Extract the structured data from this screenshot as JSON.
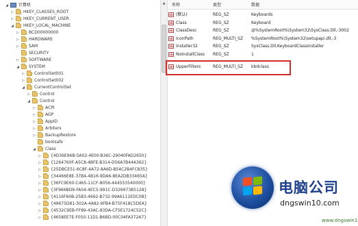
{
  "tree": {
    "items": [
      {
        "label": "计算机",
        "depth": 0,
        "icon": "computer-icon",
        "expander": "expanded"
      },
      {
        "label": "HKEY_CLASSES_ROOT",
        "depth": 1,
        "icon": "folder-icon",
        "expander": "collapsed"
      },
      {
        "label": "HKEY_CURRENT_USER",
        "depth": 1,
        "icon": "folder-icon",
        "expander": "collapsed"
      },
      {
        "label": "HKEY_LOCAL_MACHINE",
        "depth": 1,
        "icon": "folder-icon",
        "expander": "expanded"
      },
      {
        "label": "BCD00000000",
        "depth": 2,
        "icon": "folder-icon",
        "expander": "collapsed"
      },
      {
        "label": "HARDWARE",
        "depth": 2,
        "icon": "folder-icon",
        "expander": "collapsed"
      },
      {
        "label": "SAM",
        "depth": 2,
        "icon": "folder-icon",
        "expander": "collapsed"
      },
      {
        "label": "SECURITY",
        "depth": 2,
        "icon": "folder-icon",
        "expander": "none"
      },
      {
        "label": "SOFTWARE",
        "depth": 2,
        "icon": "folder-icon",
        "expander": "collapsed"
      },
      {
        "label": "SYSTEM",
        "depth": 2,
        "icon": "folder-icon",
        "expander": "expanded"
      },
      {
        "label": "ControlSet001",
        "depth": 3,
        "icon": "folder-icon",
        "expander": "collapsed"
      },
      {
        "label": "ControlSet002",
        "depth": 3,
        "icon": "folder-icon",
        "expander": "collapsed"
      },
      {
        "label": "CurrentControlSet",
        "depth": 3,
        "icon": "folder-icon",
        "expander": "expanded"
      },
      {
        "label": "Control",
        "depth": 4,
        "icon": "folder-icon",
        "expander": "collapsed"
      },
      {
        "label": "Control",
        "depth": 4,
        "icon": "folder-icon",
        "expander": "expanded"
      },
      {
        "label": "ACPI",
        "depth": 5,
        "icon": "folder-icon",
        "expander": "collapsed"
      },
      {
        "label": "AGP",
        "depth": 5,
        "icon": "folder-icon",
        "expander": "collapsed"
      },
      {
        "label": "AppID",
        "depth": 5,
        "icon": "folder-icon",
        "expander": "collapsed"
      },
      {
        "label": "Arbiters",
        "depth": 5,
        "icon": "folder-icon",
        "expander": "collapsed"
      },
      {
        "label": "BackupRestore",
        "depth": 5,
        "icon": "folder-icon",
        "expander": "collapsed"
      },
      {
        "label": "bootsafe",
        "depth": 5,
        "icon": "folder-icon",
        "expander": "none"
      },
      {
        "label": "Class",
        "depth": 5,
        "icon": "folder-icon",
        "expander": "expanded"
      },
      {
        "label": "{4D36E96B-5A02-4E00-B36C-29040FAD2650}",
        "depth": 6,
        "icon": "folder-icon",
        "expander": "collapsed"
      },
      {
        "label": "{1264760F-A5C8-4BFE-B314-D56A7B44A362}",
        "depth": 6,
        "icon": "folder-icon",
        "expander": "collapsed"
      },
      {
        "label": "{25DBCE51-6C8F-4A72-8A6D-B54C2B4FC835}",
        "depth": 6,
        "icon": "folder-icon",
        "expander": "collapsed"
      },
      {
        "label": "{34466E8E-37B4-4B16-9DA6-8EA2DB33465A}",
        "depth": 6,
        "icon": "folder-icon",
        "expander": "collapsed"
      },
      {
        "label": "{36FC9E60-C465-11CF-8056-444553540000}",
        "depth": 6,
        "icon": "folder-icon",
        "expander": "collapsed"
      },
      {
        "label": "{3F966BD9-FA04-4EC5-991C-D326973B5128}",
        "depth": 6,
        "icon": "folder-icon",
        "expander": "collapsed"
      },
      {
        "label": "{4116F60B-25B3-4662-B732-99A6111EDC0B}",
        "depth": 6,
        "icon": "folder-icon",
        "expander": "collapsed"
      },
      {
        "label": "{49675D81-502A-4A82-9FB4-B75F418C5DEA}",
        "depth": 6,
        "icon": "folder-icon",
        "expander": "collapsed"
      },
      {
        "label": "{4532C9EB-FF89-43AC-83DA-CF5E1724C52C}",
        "depth": 6,
        "icon": "folder-icon",
        "expander": "collapsed"
      },
      {
        "label": "{4658EE7E-F050-11D1-B6BD-00C04FA372A7}",
        "depth": 6,
        "icon": "folder-icon",
        "expander": "collapsed"
      }
    ]
  },
  "values": {
    "headers": {
      "name": "名称",
      "type": "类型",
      "data": "数据"
    },
    "rows": [
      {
        "name": "(默认)",
        "type": "REG_SZ",
        "data": "Keyboards"
      },
      {
        "name": "Class",
        "type": "REG_SZ",
        "data": "Keyboard"
      },
      {
        "name": "ClassDesc",
        "type": "REG_SZ",
        "data": "@%SystemRoot%\\System32\\SysClass.Dll,-3002"
      },
      {
        "name": "IconPath",
        "type": "REG_MULTI_SZ",
        "data": "%SystemRoot%\\System32\\setupapi.dll,-3"
      },
      {
        "name": "Installer32",
        "type": "REG_SZ",
        "data": "SysClass.Dll,KeyboardClassInstaller"
      },
      {
        "name": "NoInstallClass",
        "type": "REG_SZ",
        "data": "1"
      },
      {
        "name": "UpperFilters",
        "type": "REG_MULTI_SZ",
        "data": "kbdclass"
      }
    ]
  },
  "watermark": {
    "title": "电脑公司",
    "url": "dngswin10.com",
    "bottom": "www.dngswin10.com"
  },
  "colors": {
    "highlight": "#d42a2a",
    "brand": "#1d3f8a"
  }
}
